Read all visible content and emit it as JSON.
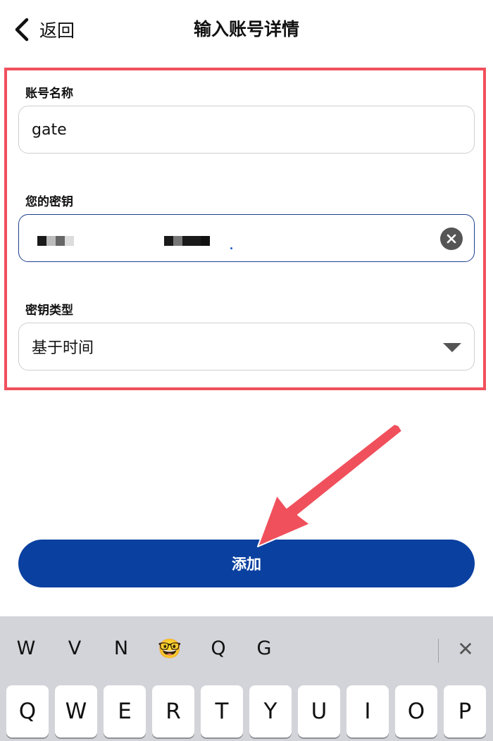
{
  "nav": {
    "back_label": "返回",
    "title": "输入账号详情"
  },
  "form": {
    "account_name": {
      "label": "账号名称",
      "value": "gate"
    },
    "secret_key": {
      "label": "您的密钥"
    },
    "key_type": {
      "label": "密钥类型",
      "selected": "基于时间"
    }
  },
  "add_button": {
    "label": "添加"
  },
  "keyboard": {
    "suggestions": [
      "W",
      "V",
      "N",
      "🤓",
      "Q",
      "G"
    ],
    "close_symbol": "✕",
    "keys": [
      "Q",
      "W",
      "E",
      "R",
      "T",
      "Y",
      "U",
      "I",
      "O",
      "P"
    ]
  },
  "colors": {
    "accent": "#0a40a0",
    "highlight": "#f0505c",
    "arrow": "#f0505c"
  },
  "icons": {
    "back": "chevron-left-icon",
    "clear": "clear-circle-icon",
    "dropdown": "triangle-down-icon"
  }
}
